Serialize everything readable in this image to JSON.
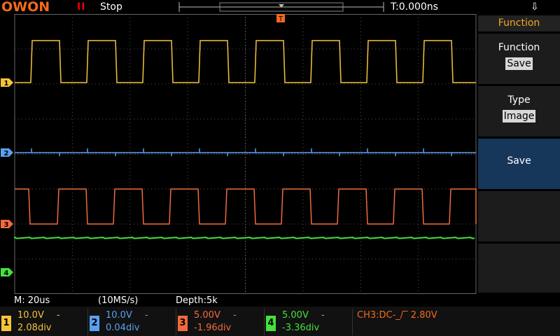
{
  "topbar": {
    "logo": "OWON",
    "run_icon": "II",
    "run_state": "Stop",
    "trigger_time": "T:0.000ns",
    "usb_icon": "usb-icon"
  },
  "trigger_marker": "T",
  "channels": [
    {
      "number": "1",
      "marker": "1",
      "color": "#f5c33b",
      "volts": "10.0V",
      "coupling": "-",
      "offset": "2.08div"
    },
    {
      "number": "2",
      "marker": "2",
      "color": "#5aa0f0",
      "volts": "10.0V",
      "coupling": "-",
      "offset": "0.04div"
    },
    {
      "number": "3",
      "marker": "3",
      "color": "#f36a3d",
      "volts": "5.00V",
      "coupling": "-",
      "offset": "-1.96div"
    },
    {
      "number": "4",
      "marker": "4",
      "color": "#44e23a",
      "volts": "5.00V",
      "coupling": "-",
      "offset": "-3.36div"
    }
  ],
  "info": {
    "timebase": "M: 20us",
    "sample_rate": "(10MS/s)",
    "depth": "Depth:5k"
  },
  "trigger_info": "CH3:DC-_/‾ 2.80V",
  "menu": {
    "title": "Function",
    "function_label": "Function",
    "function_value": "Save",
    "type_label": "Type",
    "type_value": "Image",
    "save_label": "Save"
  }
}
